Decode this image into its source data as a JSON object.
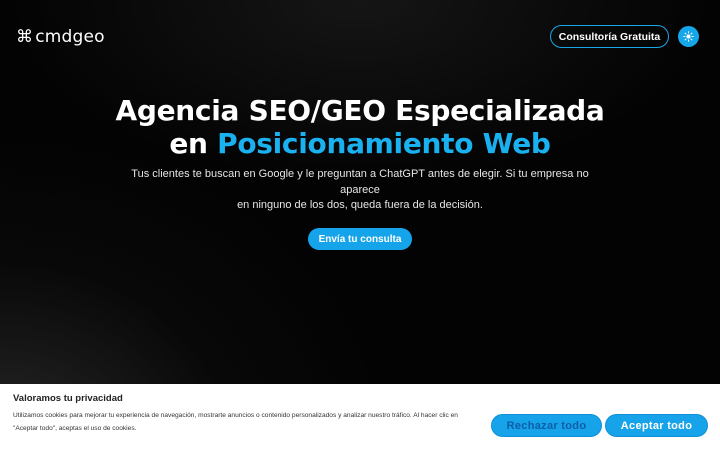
{
  "header": {
    "logo_icon": "⌘",
    "logo_text": "cmdgeo",
    "consult_label": "Consultoría Gratuita",
    "theme_icon": "sun-icon"
  },
  "hero": {
    "title_line1": "Agencia SEO/GEO Especializada",
    "title_line2_prefix": "en ",
    "title_line2_accent": "Posicionamiento Web",
    "subtitle_line1": "Tus clientes te buscan en Google y le preguntan a ChatGPT antes de elegir. Si tu empresa no aparece",
    "subtitle_line2": "en ninguno de los dos, queda fuera de la decisión.",
    "cta_label": "Envía tu consulta"
  },
  "cookie": {
    "title": "Valoramos tu privacidad",
    "text_line1": "Utilizamos cookies para mejorar tu experiencia de navegación, mostrarte anuncios o contenido personalizados y analizar nuestro tráfico. Al hacer clic en",
    "text_line2": "\"Aceptar todo\", aceptas el uso de cookies.",
    "reject_label": "Rechazar todo",
    "accept_label": "Aceptar todo"
  },
  "colors": {
    "accent": "#1ab1f0",
    "button": "#15a4ea",
    "background": "#000000"
  }
}
